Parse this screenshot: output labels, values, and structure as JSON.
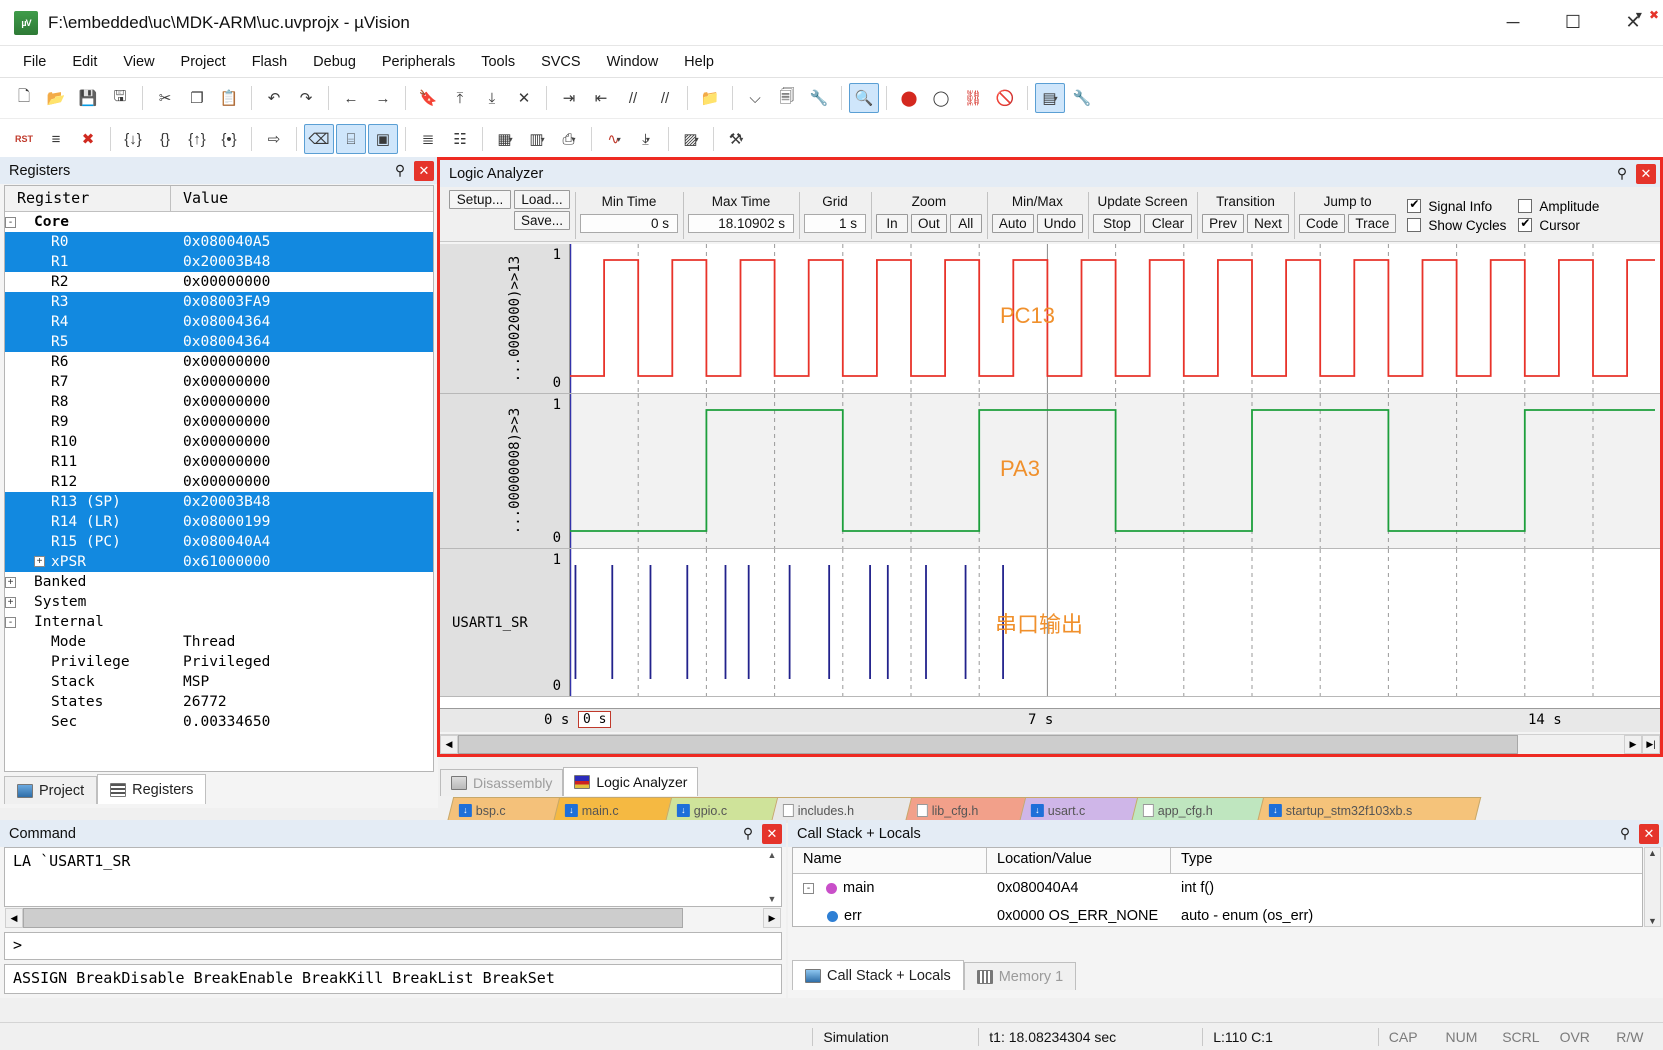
{
  "window": {
    "title": "F:\\embedded\\uc\\MDK-ARM\\uc.uvprojx - µVision",
    "app_icon_text": "µV",
    "minimize": "─",
    "maximize": "☐",
    "close": "✕"
  },
  "menu": [
    "File",
    "Edit",
    "View",
    "Project",
    "Flash",
    "Debug",
    "Peripherals",
    "Tools",
    "SVCS",
    "Window",
    "Help"
  ],
  "toolbar1": [
    {
      "name": "new-file",
      "glyph": "🗋"
    },
    {
      "name": "open-file",
      "glyph": "📂"
    },
    {
      "name": "save-file",
      "glyph": "💾"
    },
    {
      "name": "save-all",
      "glyph": "🖫"
    },
    {
      "name": "cut",
      "glyph": "✂"
    },
    {
      "name": "copy",
      "glyph": "❐"
    },
    {
      "name": "paste",
      "glyph": "📋"
    },
    {
      "name": "undo",
      "glyph": "↶"
    },
    {
      "name": "redo",
      "glyph": "↷"
    },
    {
      "name": "navigate-back",
      "glyph": "←"
    },
    {
      "name": "navigate-forward",
      "glyph": "→"
    },
    {
      "name": "bookmark-toggle",
      "glyph": "🔖"
    },
    {
      "name": "bookmark-prev",
      "glyph": "⤒"
    },
    {
      "name": "bookmark-next",
      "glyph": "⤓"
    },
    {
      "name": "bookmark-clear",
      "glyph": "✕"
    },
    {
      "name": "indent-right",
      "glyph": "⇥"
    },
    {
      "name": "indent-left",
      "glyph": "⇤"
    },
    {
      "name": "comment-lines",
      "glyph": "//"
    },
    {
      "name": "uncomment-lines",
      "glyph": "//"
    },
    {
      "name": "open-folder",
      "glyph": "📁"
    },
    {
      "name": "target-select-dropdown",
      "glyph": "⌵"
    },
    {
      "name": "target-options",
      "glyph": "🗐"
    },
    {
      "name": "manage-components",
      "glyph": "🔧"
    },
    {
      "name": "start-stop-debug",
      "glyph": "🔍"
    },
    {
      "name": "insert-breakpoint",
      "glyph": "⬤"
    },
    {
      "name": "disable-breakpoint",
      "glyph": "◯"
    },
    {
      "name": "disable-all-breakpoints",
      "glyph": "⛓"
    },
    {
      "name": "kill-all-breakpoints",
      "glyph": "🚫"
    },
    {
      "name": "window-layout",
      "glyph": "▤"
    },
    {
      "name": "configure-tools",
      "glyph": "🔧"
    }
  ],
  "toolbar2": [
    {
      "name": "reset-cpu",
      "glyph": "RST"
    },
    {
      "name": "run-trace",
      "glyph": "≡"
    },
    {
      "name": "stop-debug",
      "glyph": "✖"
    },
    {
      "name": "step-into",
      "glyph": "{↓}"
    },
    {
      "name": "step-over",
      "glyph": "{}"
    },
    {
      "name": "step-out",
      "glyph": "{↑}"
    },
    {
      "name": "run-to-cursor",
      "glyph": "{•}"
    },
    {
      "name": "show-next-statement",
      "glyph": "⇨"
    },
    {
      "name": "command-window",
      "glyph": "⌫"
    },
    {
      "name": "disassembly-window",
      "glyph": "⌸"
    },
    {
      "name": "symbol-window",
      "glyph": "▣"
    },
    {
      "name": "registers-window",
      "glyph": "≣"
    },
    {
      "name": "call-stack-window",
      "glyph": "☷"
    },
    {
      "name": "watch-windows",
      "glyph": "▦"
    },
    {
      "name": "memory-windows",
      "glyph": "▥"
    },
    {
      "name": "serial-windows",
      "glyph": "⎙"
    },
    {
      "name": "analysis-windows",
      "glyph": "∿"
    },
    {
      "name": "trace-windows",
      "glyph": "⤓"
    },
    {
      "name": "system-viewer",
      "glyph": "▨"
    },
    {
      "name": "toolbox",
      "glyph": "⚒"
    }
  ],
  "registers": {
    "title": "Registers",
    "pin_icon": "中",
    "close_icon": "✕",
    "columns": [
      "Register",
      "Value"
    ],
    "rows": [
      {
        "indent": 0,
        "toggle": "-",
        "name": "Core",
        "value": "",
        "selected": false,
        "bold": true
      },
      {
        "indent": 1,
        "toggle": "",
        "name": "R0",
        "value": "0x080040A5",
        "selected": true
      },
      {
        "indent": 1,
        "toggle": "",
        "name": "R1",
        "value": "0x20003B48",
        "selected": true
      },
      {
        "indent": 1,
        "toggle": "",
        "name": "R2",
        "value": "0x00000000",
        "selected": false
      },
      {
        "indent": 1,
        "toggle": "",
        "name": "R3",
        "value": "0x08003FA9",
        "selected": true
      },
      {
        "indent": 1,
        "toggle": "",
        "name": "R4",
        "value": "0x08004364",
        "selected": true
      },
      {
        "indent": 1,
        "toggle": "",
        "name": "R5",
        "value": "0x08004364",
        "selected": true
      },
      {
        "indent": 1,
        "toggle": "",
        "name": "R6",
        "value": "0x00000000",
        "selected": false
      },
      {
        "indent": 1,
        "toggle": "",
        "name": "R7",
        "value": "0x00000000",
        "selected": false
      },
      {
        "indent": 1,
        "toggle": "",
        "name": "R8",
        "value": "0x00000000",
        "selected": false
      },
      {
        "indent": 1,
        "toggle": "",
        "name": "R9",
        "value": "0x00000000",
        "selected": false
      },
      {
        "indent": 1,
        "toggle": "",
        "name": "R10",
        "value": "0x00000000",
        "selected": false
      },
      {
        "indent": 1,
        "toggle": "",
        "name": "R11",
        "value": "0x00000000",
        "selected": false
      },
      {
        "indent": 1,
        "toggle": "",
        "name": "R12",
        "value": "0x00000000",
        "selected": false
      },
      {
        "indent": 1,
        "toggle": "",
        "name": "R13 (SP)",
        "value": "0x20003B48",
        "selected": true
      },
      {
        "indent": 1,
        "toggle": "",
        "name": "R14 (LR)",
        "value": "0x08000199",
        "selected": true
      },
      {
        "indent": 1,
        "toggle": "",
        "name": "R15 (PC)",
        "value": "0x080040A4",
        "selected": true
      },
      {
        "indent": 1,
        "toggle": "+",
        "name": "xPSR",
        "value": "0x61000000",
        "selected": true
      },
      {
        "indent": 0,
        "toggle": "+",
        "name": "Banked",
        "value": "",
        "selected": false
      },
      {
        "indent": 0,
        "toggle": "+",
        "name": "System",
        "value": "",
        "selected": false
      },
      {
        "indent": 0,
        "toggle": "-",
        "name": "Internal",
        "value": "",
        "selected": false
      },
      {
        "indent": 1,
        "toggle": "",
        "name": "Mode",
        "value": "Thread",
        "selected": false
      },
      {
        "indent": 1,
        "toggle": "",
        "name": "Privilege",
        "value": "Privileged",
        "selected": false
      },
      {
        "indent": 1,
        "toggle": "",
        "name": "Stack",
        "value": "MSP",
        "selected": false
      },
      {
        "indent": 1,
        "toggle": "",
        "name": "States",
        "value": "26772",
        "selected": false
      },
      {
        "indent": 1,
        "toggle": "",
        "name": "Sec",
        "value": "0.00334650",
        "selected": false
      }
    ],
    "bottom_tabs": [
      {
        "label": "Project",
        "icon": "project-icon",
        "active": false
      },
      {
        "label": "Registers",
        "icon": "registers-icon",
        "active": true
      }
    ]
  },
  "logic_analyzer": {
    "title": "Logic Analyzer",
    "pin_icon": "中",
    "close_icon": "✕",
    "toolbar": {
      "setup_label": "Setup...",
      "load_label": "Load...",
      "save_label": "Save...",
      "min_time_label": "Min Time",
      "min_time_value": "0 s",
      "max_time_label": "Max Time",
      "max_time_value": "18.10902 s",
      "grid_label": "Grid",
      "grid_value": "1 s",
      "zoom_label": "Zoom",
      "zoom_buttons": [
        "In",
        "Out",
        "All"
      ],
      "minmax_label": "Min/Max",
      "minmax_buttons": [
        "Auto",
        "Undo"
      ],
      "update_screen_label": "Update Screen",
      "update_screen_buttons": [
        "Stop",
        "Clear"
      ],
      "transition_label": "Transition",
      "transition_buttons": [
        "Prev",
        "Next"
      ],
      "jumpto_label": "Jump to",
      "jumpto_buttons": [
        "Code",
        "Trace"
      ],
      "checkboxes": [
        {
          "label": "Signal Info",
          "checked": true
        },
        {
          "label": "Show Cycles",
          "checked": false
        },
        {
          "label": "Amplitude",
          "checked": false
        },
        {
          "label": "Cursor",
          "checked": true
        }
      ]
    },
    "axis": {
      "left_label": "0 s",
      "mid_label": "7 s",
      "right_label": "14 s",
      "cursor_label": "0 s",
      "min": 0,
      "max": 18.10902,
      "grid_seconds": 1
    },
    "signals": [
      {
        "label": "...0002000)>>13",
        "display_name": "PC13",
        "color": "#e8332a",
        "top_value": "1",
        "bottom_value": "0",
        "kind": "square",
        "period": 1.0,
        "duty": 0.5,
        "phase": 0.5
      },
      {
        "label": "...00000008)>>3",
        "display_name": "PA3",
        "color": "#1d9f3c",
        "top_value": "1",
        "bottom_value": "0",
        "kind": "square",
        "period": 4.0,
        "duty": 0.5,
        "phase": 2.0
      },
      {
        "label": "USART1_SR",
        "display_name": "串口输出",
        "color": "#22228c",
        "top_value": "1",
        "bottom_value": "0",
        "kind": "pulses",
        "pulse_times": [
          0.08,
          0.62,
          1.18,
          1.72,
          2.28,
          2.62,
          3.22,
          3.8,
          4.4,
          4.66,
          5.22,
          5.8,
          6.35
        ]
      }
    ],
    "bottom_tabs": [
      {
        "label": "Disassembly",
        "icon": "disassembly-icon",
        "active": false
      },
      {
        "label": "Logic Analyzer",
        "icon": "logic-analyzer-icon",
        "active": true
      }
    ]
  },
  "file_tabs": [
    {
      "label": "bsp.c",
      "color": "#f4c17a",
      "icon": "c-source-icon"
    },
    {
      "label": "main.c",
      "color": "#f5b942",
      "icon": "c-source-icon"
    },
    {
      "label": "gpio.c",
      "color": "#cfe39a",
      "icon": "c-source-icon"
    },
    {
      "label": "includes.h",
      "color": "#e8e8e8",
      "icon": "header-icon"
    },
    {
      "label": "lib_cfg.h",
      "color": "#f2a08a",
      "icon": "header-icon"
    },
    {
      "label": "usart.c",
      "color": "#cfb6e8",
      "icon": "c-source-icon"
    },
    {
      "label": "app_cfg.h",
      "color": "#bfe6bf",
      "icon": "header-icon"
    },
    {
      "label": "startup_stm32f103xb.s",
      "color": "#f5c37a",
      "icon": "asm-source-icon"
    }
  ],
  "command": {
    "title": "Command",
    "pin_icon": "中",
    "close_icon": "✕",
    "log": "LA `USART1_SR",
    "prompt": ">",
    "buttons_line": "ASSIGN BreakDisable BreakEnable BreakKill BreakList BreakSet"
  },
  "call_stack": {
    "title": "Call Stack + Locals",
    "pin_icon": "中",
    "close_icon": "✕",
    "columns": [
      "Name",
      "Location/Value",
      "Type"
    ],
    "rows": [
      {
        "toggle": "-",
        "icon": "function-icon",
        "name": "main",
        "location": "0x080040A4",
        "type": "int f()"
      },
      {
        "toggle": "",
        "icon": "variable-icon",
        "name": "err",
        "location": "0x0000 OS_ERR_NONE",
        "type": "auto - enum (os_err)"
      }
    ],
    "bottom_tabs": [
      {
        "label": "Call Stack + Locals",
        "icon": "call-stack-icon",
        "active": true
      },
      {
        "label": "Memory 1",
        "icon": "memory-icon",
        "active": false
      }
    ]
  },
  "status_bar": {
    "mode": "Simulation",
    "time": "t1: 18.08234304 sec",
    "position": "L:110 C:1",
    "indicators": [
      "CAP",
      "NUM",
      "SCRL",
      "OVR",
      "R/W"
    ]
  }
}
